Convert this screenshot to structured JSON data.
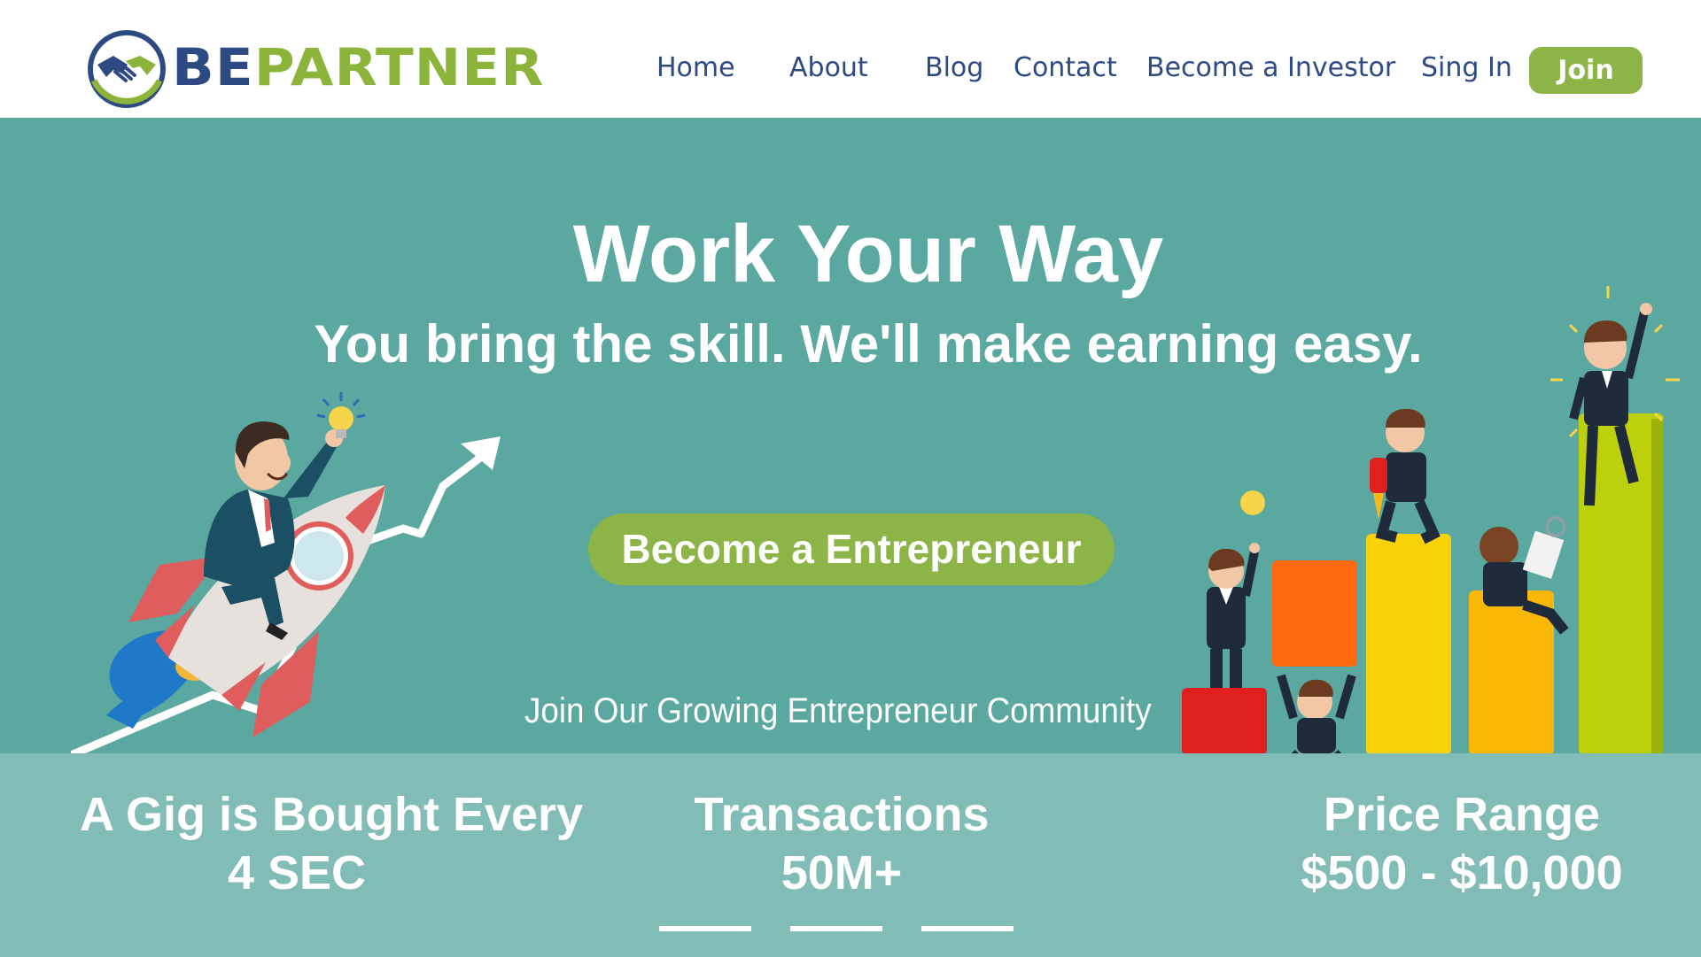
{
  "brand": {
    "part1": "BE",
    "part2": "PARTNER",
    "colors": {
      "blue": "#2e4a82",
      "green": "#8cb43a"
    },
    "icon": "handshake-icon"
  },
  "nav": {
    "items": [
      {
        "label": "Home"
      },
      {
        "label": "About"
      },
      {
        "label": "Blog"
      },
      {
        "label": "Contact"
      },
      {
        "label": "Become a Investor"
      },
      {
        "label": "Sing In"
      }
    ],
    "join_label": "Join"
  },
  "hero": {
    "title": "Work Your Way",
    "subtitle": "You bring the skill. We'll make earning easy.",
    "cta_label": "Become a Entrepreneur",
    "community_text": "Join Our Growing Entrepreneur Community",
    "background": "#5aa89f",
    "illustrations": [
      "rocket-businessman-illustration",
      "growth-bar-chart-team-illustration"
    ]
  },
  "stats": [
    {
      "line1": "A Gig is Bought Every",
      "line2": "4 SEC"
    },
    {
      "line1": "Transactions",
      "line2": "50M+"
    },
    {
      "line1": "Price Range",
      "line2": "$500 - $10,000"
    }
  ],
  "carousel": {
    "slides": 3
  },
  "colors": {
    "accent": "#8cb446",
    "stats_band": "#82bcb6"
  }
}
